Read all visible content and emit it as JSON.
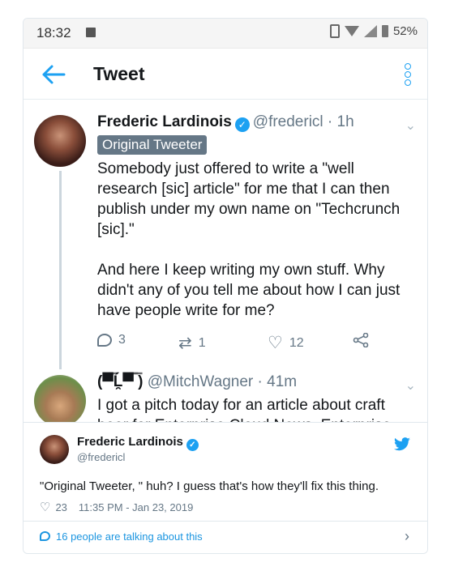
{
  "status_bar": {
    "time": "18:32",
    "battery": "52%"
  },
  "app_bar": {
    "title": "Tweet"
  },
  "tweet": {
    "author_name": "Frederic Lardinois",
    "handle_time": "@fredericl · 1h",
    "badge": "Original Tweeter",
    "text": "Somebody just offered to write a \"well research [sic] article\" for me that I can then publish under my own name on \"Techcrunch [sic].\"\n\nAnd here I keep writing my own stuff. Why didn't any of you tell me about how I can just have people write for me?",
    "replies": "3",
    "retweets": "1",
    "likes": "12"
  },
  "reply": {
    "author_name": "(▀̿Ĺ̯▀̿ ̿)",
    "handle_time": "@MitchWagner · 41m",
    "text": "I got a pitch today for an article about craft beer for Enterprise Cloud News. Enterprise"
  },
  "embed_card": {
    "author_name": "Frederic Lardinois",
    "handle": "@fredericl",
    "text": "\"Original Tweeter, \" huh? I guess that's how they'll fix this thing.",
    "likes": "23",
    "timestamp": "11:35 PM - Jan 23, 2019"
  },
  "footer": {
    "talking_text": "16 people are talking about this"
  },
  "colors": {
    "twitter_blue": "#1da1f2",
    "gray": "#657786"
  }
}
